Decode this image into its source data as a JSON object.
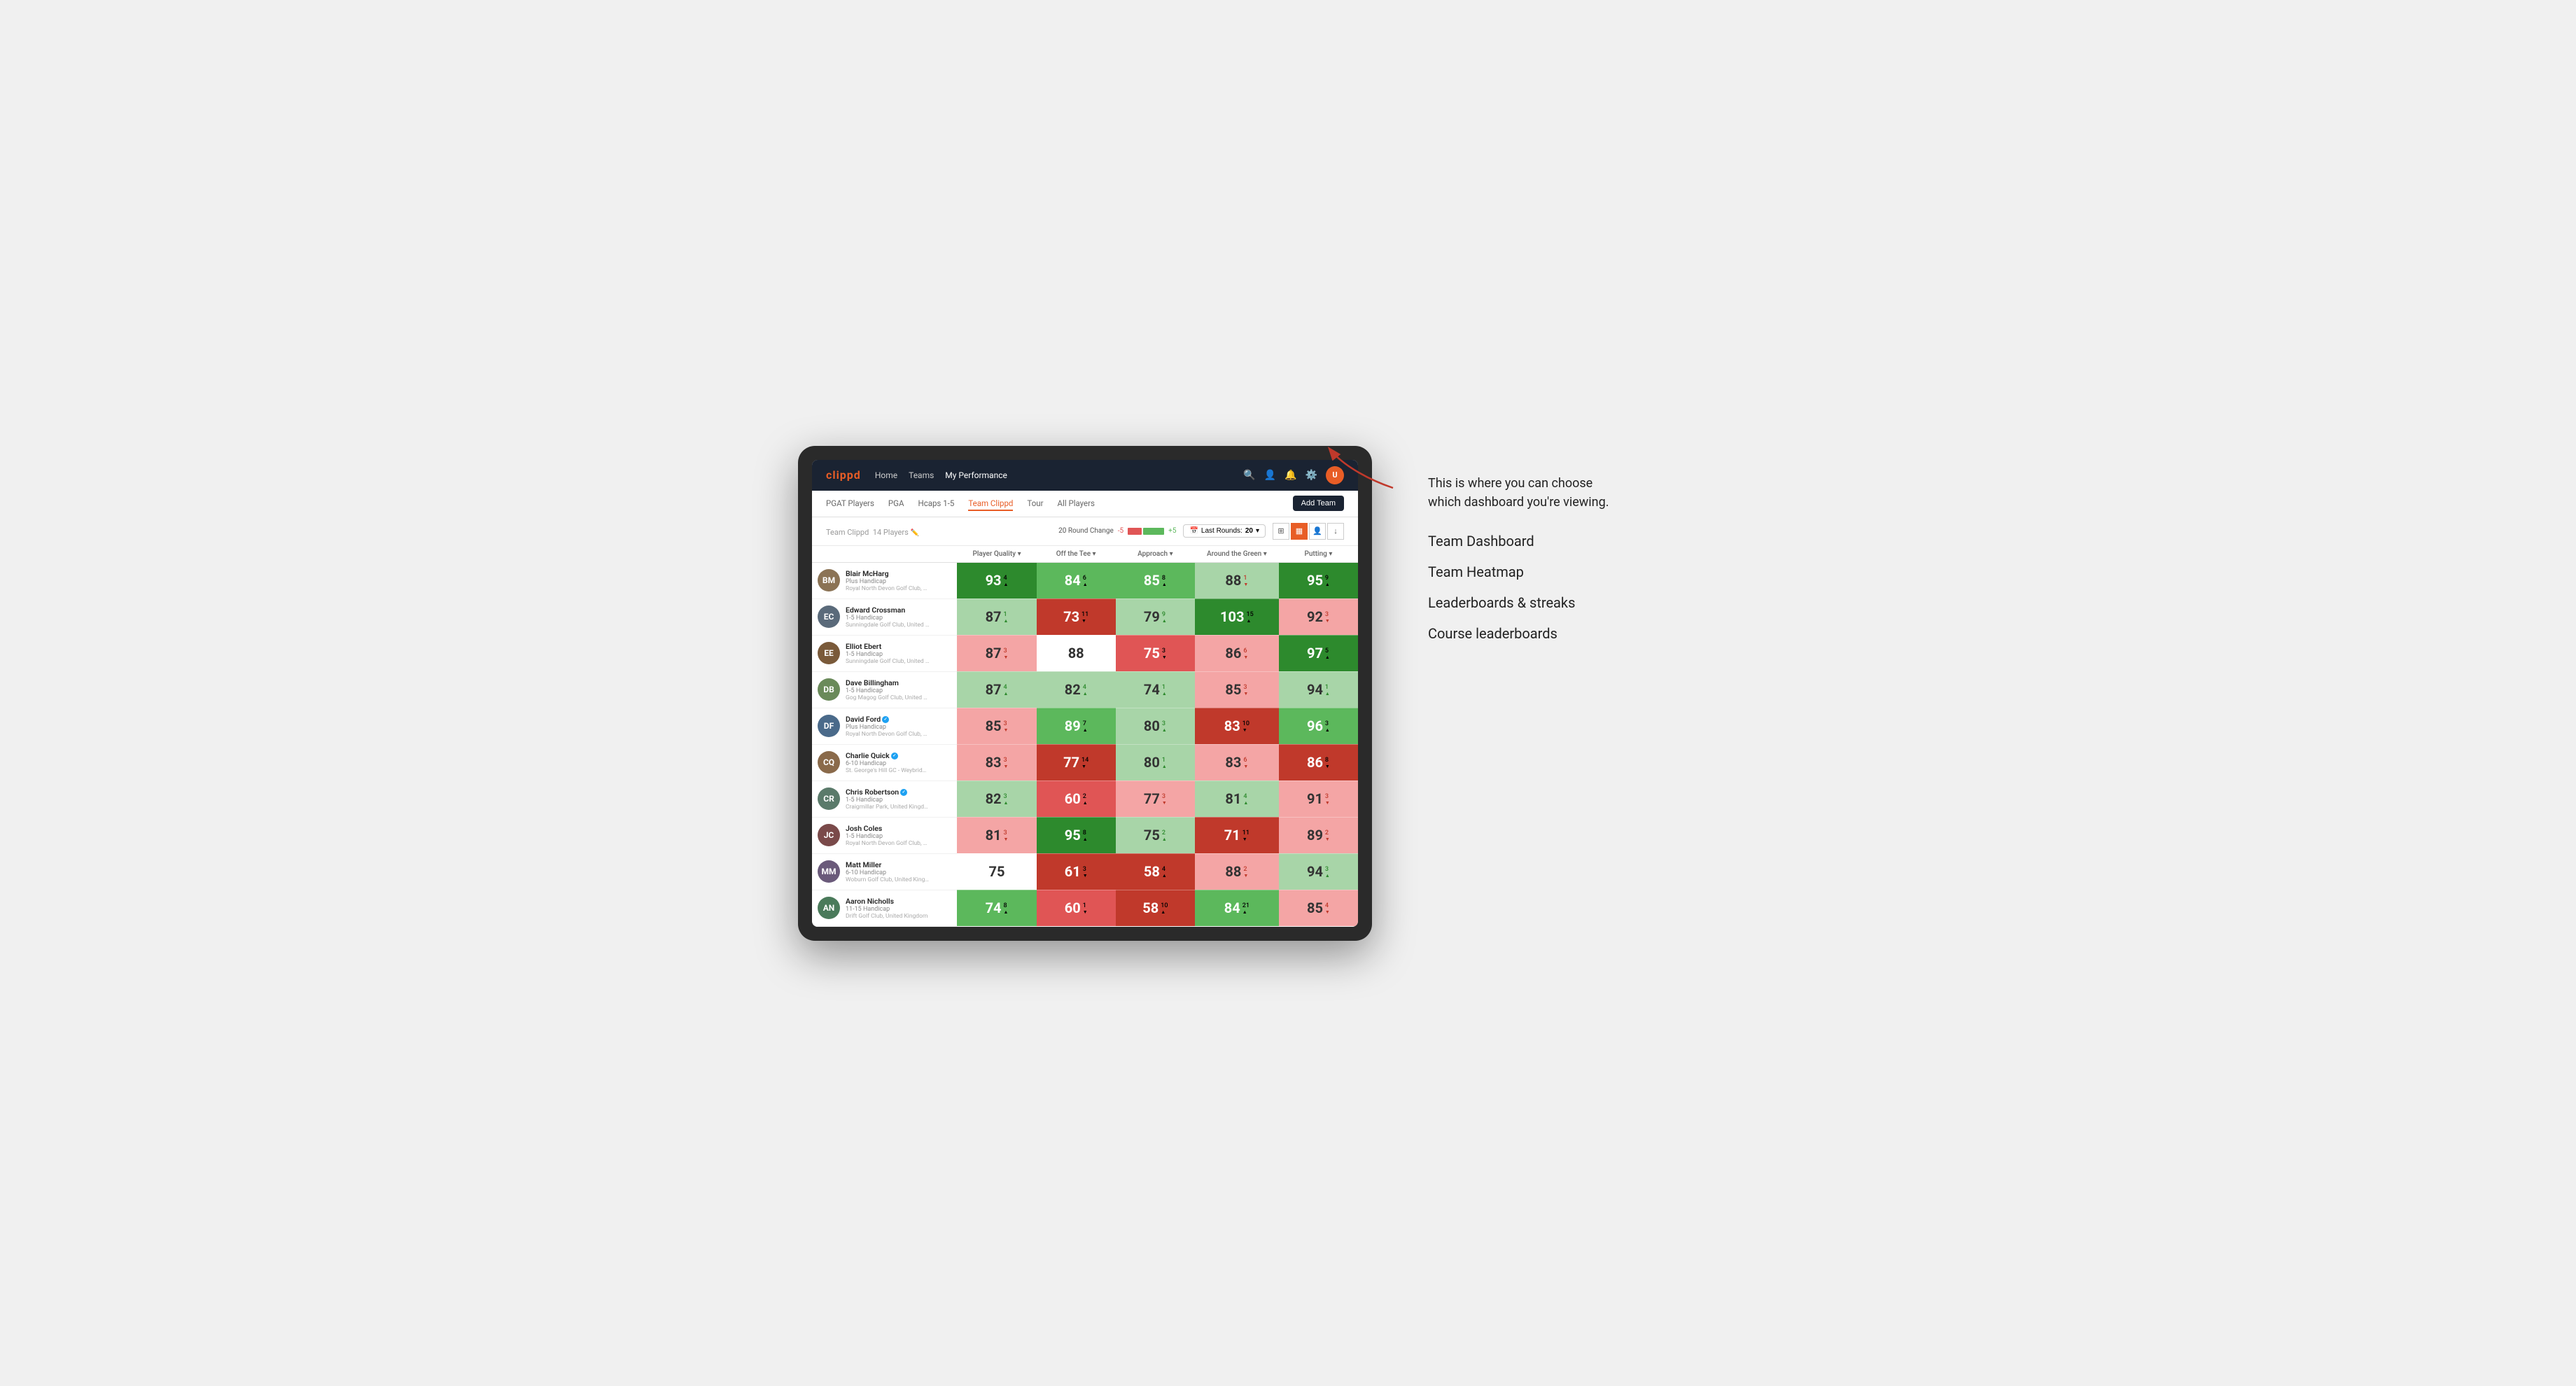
{
  "app": {
    "logo": "clippd",
    "nav_links": [
      {
        "label": "Home",
        "active": false
      },
      {
        "label": "Teams",
        "active": false
      },
      {
        "label": "My Performance",
        "active": true
      }
    ],
    "secondary_nav": [
      {
        "label": "PGAT Players",
        "active": false
      },
      {
        "label": "PGA",
        "active": false
      },
      {
        "label": "Hcaps 1-5",
        "active": false
      },
      {
        "label": "Team Clippd",
        "active": true
      },
      {
        "label": "Tour",
        "active": false
      },
      {
        "label": "All Players",
        "active": false
      }
    ],
    "add_team_button": "Add Team"
  },
  "team": {
    "name": "Team Clippd",
    "count": "14 Players",
    "round_change_label": "20 Round Change",
    "change_minus": "-5",
    "change_plus": "+5",
    "last_rounds_label": "Last Rounds:",
    "last_rounds_value": "20",
    "view_buttons": [
      "grid",
      "heatmap",
      "list",
      "export"
    ]
  },
  "table": {
    "columns": [
      {
        "label": "Player Quality ▾",
        "key": "quality"
      },
      {
        "label": "Off the Tee ▾",
        "key": "tee"
      },
      {
        "label": "Approach ▾",
        "key": "approach"
      },
      {
        "label": "Around the Green ▾",
        "key": "around"
      },
      {
        "label": "Putting ▾",
        "key": "putting"
      }
    ],
    "players": [
      {
        "name": "Blair McHarg",
        "handicap": "Plus Handicap",
        "club": "Royal North Devon Golf Club, United Kingdom",
        "avatar_color": "#8B7355",
        "initials": "BM",
        "quality": {
          "value": 93,
          "change": 4,
          "dir": "up",
          "bg": "bg-green-strong"
        },
        "tee": {
          "value": 84,
          "change": 6,
          "dir": "up",
          "bg": "bg-green-mid"
        },
        "approach": {
          "value": 85,
          "change": 8,
          "dir": "up",
          "bg": "bg-green-mid"
        },
        "around": {
          "value": 88,
          "change": 1,
          "dir": "down",
          "bg": "bg-green-light"
        },
        "putting": {
          "value": 95,
          "change": 9,
          "dir": "up",
          "bg": "bg-green-strong"
        }
      },
      {
        "name": "Edward Crossman",
        "handicap": "1-5 Handicap",
        "club": "Sunningdale Golf Club, United Kingdom",
        "avatar_color": "#5a6a7a",
        "initials": "EC",
        "quality": {
          "value": 87,
          "change": 1,
          "dir": "up",
          "bg": "bg-green-light"
        },
        "tee": {
          "value": 73,
          "change": 11,
          "dir": "down",
          "bg": "bg-red-strong"
        },
        "approach": {
          "value": 79,
          "change": 9,
          "dir": "up",
          "bg": "bg-green-light"
        },
        "around": {
          "value": 103,
          "change": 15,
          "dir": "up",
          "bg": "bg-green-strong"
        },
        "putting": {
          "value": 92,
          "change": 3,
          "dir": "down",
          "bg": "bg-red-light"
        }
      },
      {
        "name": "Elliot Ebert",
        "handicap": "1-5 Handicap",
        "club": "Sunningdale Golf Club, United Kingdom",
        "avatar_color": "#7a5a3a",
        "initials": "EE",
        "quality": {
          "value": 87,
          "change": 3,
          "dir": "down",
          "bg": "bg-red-light"
        },
        "tee": {
          "value": 88,
          "change": 0,
          "dir": "",
          "bg": "bg-white"
        },
        "approach": {
          "value": 75,
          "change": 3,
          "dir": "down",
          "bg": "bg-red-mid"
        },
        "around": {
          "value": 86,
          "change": 6,
          "dir": "down",
          "bg": "bg-red-light"
        },
        "putting": {
          "value": 97,
          "change": 5,
          "dir": "up",
          "bg": "bg-green-strong"
        }
      },
      {
        "name": "Dave Billingham",
        "handicap": "1-5 Handicap",
        "club": "Gog Magog Golf Club, United Kingdom",
        "avatar_color": "#6a8a5a",
        "initials": "DB",
        "quality": {
          "value": 87,
          "change": 4,
          "dir": "up",
          "bg": "bg-green-light"
        },
        "tee": {
          "value": 82,
          "change": 4,
          "dir": "up",
          "bg": "bg-green-light"
        },
        "approach": {
          "value": 74,
          "change": 1,
          "dir": "up",
          "bg": "bg-green-light"
        },
        "around": {
          "value": 85,
          "change": 3,
          "dir": "down",
          "bg": "bg-red-light"
        },
        "putting": {
          "value": 94,
          "change": 1,
          "dir": "up",
          "bg": "bg-green-light"
        }
      },
      {
        "name": "David Ford",
        "handicap": "Plus Handicap",
        "club": "Royal North Devon Golf Club, United Kingdom",
        "avatar_color": "#4a6a8a",
        "initials": "DF",
        "verified": true,
        "quality": {
          "value": 85,
          "change": 3,
          "dir": "down",
          "bg": "bg-red-light"
        },
        "tee": {
          "value": 89,
          "change": 7,
          "dir": "up",
          "bg": "bg-green-mid"
        },
        "approach": {
          "value": 80,
          "change": 3,
          "dir": "up",
          "bg": "bg-green-light"
        },
        "around": {
          "value": 83,
          "change": 10,
          "dir": "down",
          "bg": "bg-red-strong"
        },
        "putting": {
          "value": 96,
          "change": 3,
          "dir": "up",
          "bg": "bg-green-mid"
        }
      },
      {
        "name": "Charlie Quick",
        "handicap": "6-10 Handicap",
        "club": "St. George's Hill GC - Weybridge - Surrey, Uni...",
        "avatar_color": "#8a6a4a",
        "initials": "CQ",
        "verified": true,
        "quality": {
          "value": 83,
          "change": 3,
          "dir": "down",
          "bg": "bg-red-light"
        },
        "tee": {
          "value": 77,
          "change": 14,
          "dir": "down",
          "bg": "bg-red-strong"
        },
        "approach": {
          "value": 80,
          "change": 1,
          "dir": "up",
          "bg": "bg-green-light"
        },
        "around": {
          "value": 83,
          "change": 6,
          "dir": "down",
          "bg": "bg-red-light"
        },
        "putting": {
          "value": 86,
          "change": 8,
          "dir": "down",
          "bg": "bg-red-strong"
        }
      },
      {
        "name": "Chris Robertson",
        "handicap": "1-5 Handicap",
        "club": "Craigmillar Park, United Kingdom",
        "avatar_color": "#5a7a6a",
        "initials": "CR",
        "verified": true,
        "quality": {
          "value": 82,
          "change": 3,
          "dir": "up",
          "bg": "bg-green-light"
        },
        "tee": {
          "value": 60,
          "change": 2,
          "dir": "up",
          "bg": "bg-red-mid"
        },
        "approach": {
          "value": 77,
          "change": 3,
          "dir": "down",
          "bg": "bg-red-light"
        },
        "around": {
          "value": 81,
          "change": 4,
          "dir": "up",
          "bg": "bg-green-light"
        },
        "putting": {
          "value": 91,
          "change": 3,
          "dir": "down",
          "bg": "bg-red-light"
        }
      },
      {
        "name": "Josh Coles",
        "handicap": "1-5 Handicap",
        "club": "Royal North Devon Golf Club, United Kingdom",
        "avatar_color": "#7a4a4a",
        "initials": "JC",
        "quality": {
          "value": 81,
          "change": 3,
          "dir": "down",
          "bg": "bg-red-light"
        },
        "tee": {
          "value": 95,
          "change": 8,
          "dir": "up",
          "bg": "bg-green-strong"
        },
        "approach": {
          "value": 75,
          "change": 2,
          "dir": "up",
          "bg": "bg-green-light"
        },
        "around": {
          "value": 71,
          "change": 11,
          "dir": "down",
          "bg": "bg-red-strong"
        },
        "putting": {
          "value": 89,
          "change": 2,
          "dir": "down",
          "bg": "bg-red-light"
        }
      },
      {
        "name": "Matt Miller",
        "handicap": "6-10 Handicap",
        "club": "Woburn Golf Club, United Kingdom",
        "avatar_color": "#6a5a7a",
        "initials": "MM",
        "quality": {
          "value": 75,
          "change": 0,
          "dir": "",
          "bg": "bg-white"
        },
        "tee": {
          "value": 61,
          "change": 3,
          "dir": "down",
          "bg": "bg-red-strong"
        },
        "approach": {
          "value": 58,
          "change": 4,
          "dir": "up",
          "bg": "bg-red-strong"
        },
        "around": {
          "value": 88,
          "change": 2,
          "dir": "down",
          "bg": "bg-red-light"
        },
        "putting": {
          "value": 94,
          "change": 3,
          "dir": "up",
          "bg": "bg-green-light"
        }
      },
      {
        "name": "Aaron Nicholls",
        "handicap": "11-15 Handicap",
        "club": "Drift Golf Club, United Kingdom",
        "avatar_color": "#4a7a5a",
        "initials": "AN",
        "quality": {
          "value": 74,
          "change": 8,
          "dir": "up",
          "bg": "bg-green-mid"
        },
        "tee": {
          "value": 60,
          "change": 1,
          "dir": "down",
          "bg": "bg-red-mid"
        },
        "approach": {
          "value": 58,
          "change": 10,
          "dir": "up",
          "bg": "bg-red-strong"
        },
        "around": {
          "value": 84,
          "change": 21,
          "dir": "up",
          "bg": "bg-green-mid"
        },
        "putting": {
          "value": 85,
          "change": 4,
          "dir": "down",
          "bg": "bg-red-light"
        }
      }
    ]
  },
  "annotation": {
    "intro": "This is where you can choose which dashboard you're viewing.",
    "items": [
      "Team Dashboard",
      "Team Heatmap",
      "Leaderboards & streaks",
      "Course leaderboards"
    ]
  }
}
